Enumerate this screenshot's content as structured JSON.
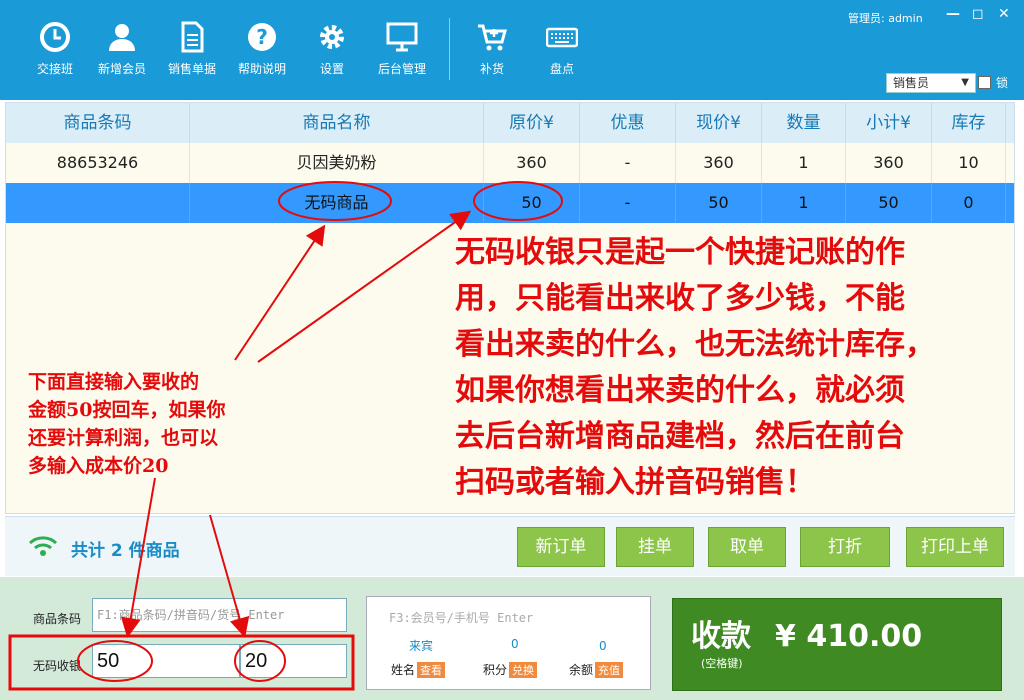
{
  "toolbar": {
    "items": [
      {
        "label": "交接班",
        "icon": "clock-icon"
      },
      {
        "label": "新增会员",
        "icon": "user-icon"
      },
      {
        "label": "销售单据",
        "icon": "document-icon"
      },
      {
        "label": "帮助说明",
        "icon": "help-icon"
      },
      {
        "label": "设置",
        "icon": "gear-icon"
      },
      {
        "label": "后台管理",
        "icon": "monitor-icon"
      },
      {
        "label": "补货",
        "icon": "cart-icon"
      },
      {
        "label": "盘点",
        "icon": "keyboard-icon"
      }
    ],
    "admin": "管理员: admin",
    "role": "销售员",
    "lock": "锁"
  },
  "grid": {
    "headers": [
      "商品条码",
      "商品名称",
      "原价¥",
      "优惠",
      "现价¥",
      "数量",
      "小计¥",
      "库存"
    ],
    "rows": [
      [
        "88653246",
        "贝因美奶粉",
        "360",
        "-",
        "360",
        "1",
        "360",
        "10"
      ],
      [
        "",
        "无码商品",
        "50",
        "-",
        "50",
        "1",
        "50",
        "0"
      ]
    ]
  },
  "summary": {
    "text": "共计 2 件商品"
  },
  "actions": [
    "新订单",
    "挂单",
    "取单",
    "打折",
    "打印上单"
  ],
  "entry": {
    "barcode_label": "商品条码",
    "barcode_placeholder": "F1:商品条码/拼音码/货号 Enter",
    "nocode_label": "无码收银",
    "amount": "50",
    "cost": "20"
  },
  "member": {
    "placeholder": "F3:会员号/手机号 Enter",
    "guest": "来宾",
    "points": "0",
    "balance": "0",
    "name_label": "姓名",
    "name_action": "查看",
    "points_label": "积分",
    "points_action": "兑换",
    "balance_label": "余额",
    "balance_action": "充值"
  },
  "pay": {
    "label": "收款",
    "hint": "(空格键)",
    "amount": "¥ 410.00"
  },
  "annotations": {
    "left_note": [
      "下面直接输入要收的",
      "金额50按回车，如果你",
      "还要计算利润，也可以",
      "多输入成本价20"
    ],
    "right_note": [
      "无码收银只是起一个快捷记账的作",
      "用，只能看出来收了多少钱，不能",
      "看出来卖的什么，也无法统计库存，",
      "如果你想看出来卖的什么，就必须",
      "去后台新增商品建档，然后在前台",
      "扫码或者输入拼音码销售！"
    ]
  },
  "colors": {
    "toolbar": "#1a9ad6",
    "selected_row": "#3399ff",
    "action_green": "#8cc54a",
    "pay_green": "#3f8a22",
    "annotation_red": "#e30b0b"
  }
}
